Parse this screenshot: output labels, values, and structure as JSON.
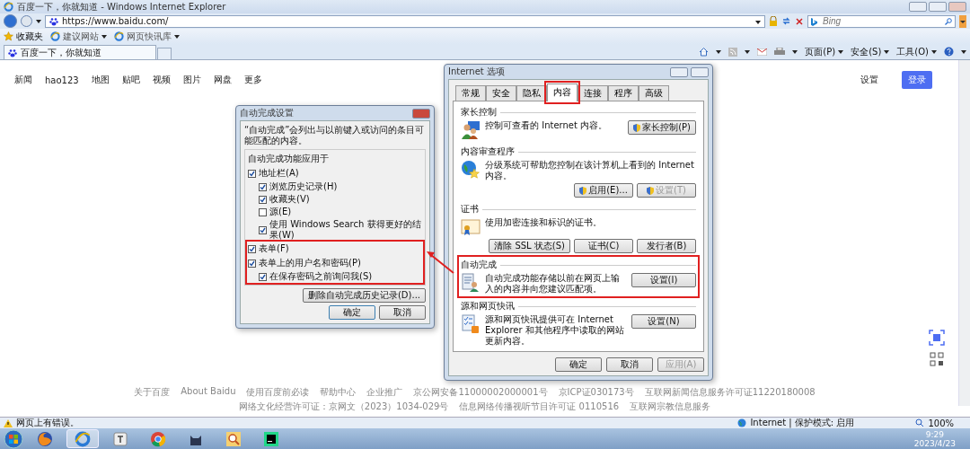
{
  "window": {
    "title": "百度一下，你就知道 - Windows Internet Explorer"
  },
  "address_bar": {
    "url": "https://www.baidu.com/"
  },
  "search": {
    "placeholder": "Bing"
  },
  "favorites_bar": {
    "items": [
      {
        "label": "收藏夹",
        "menu": false
      },
      {
        "label": "建议网站",
        "menu": true
      },
      {
        "label": "网页快讯库",
        "menu": true
      }
    ]
  },
  "tabs": [
    {
      "label": "百度一下，你就知道",
      "selected": true
    }
  ],
  "command_bar": {
    "menus": [
      "页面(P)",
      "安全(S)",
      "工具(O)"
    ]
  },
  "page": {
    "nav": [
      "新闻",
      "hao123",
      "地图",
      "贴吧",
      "视频",
      "图片",
      "网盘",
      "更多"
    ],
    "settings": "设置",
    "login": "登录",
    "footer": [
      "关于百度",
      "About Baidu",
      "使用百度前必读",
      "帮助中心",
      "企业推广",
      "京公网安备11000002000001号",
      "京ICP证030173号",
      "互联网新闻信息服务许可证11220180008",
      "网络文化经营许可证：京网文（2023）1034-029号",
      "信息网络传播视听节目许可证 0110516",
      "互联网宗教信息服务"
    ]
  },
  "internet_options": {
    "title": "Internet 选项",
    "tabs": [
      {
        "label": "常规",
        "selected": false,
        "highlighted": false
      },
      {
        "label": "安全",
        "selected": false,
        "highlighted": false
      },
      {
        "label": "隐私",
        "selected": false,
        "highlighted": false
      },
      {
        "label": "内容",
        "selected": true,
        "highlighted": true
      },
      {
        "label": "连接",
        "selected": false,
        "highlighted": false
      },
      {
        "label": "程序",
        "selected": false,
        "highlighted": false
      },
      {
        "label": "高级",
        "selected": false,
        "highlighted": false
      }
    ],
    "sections": [
      {
        "title": "家长控制",
        "text": "控制可查看的 Internet 内容。",
        "highlighted": false,
        "buttons": [
          {
            "label": "家长控制(P)",
            "disabled": false,
            "shield": true
          }
        ]
      },
      {
        "title": "内容审查程序",
        "text": "分级系统可帮助您控制在该计算机上看到的 Internet 内容。",
        "highlighted": false,
        "buttons": [
          {
            "label": "启用(E)...",
            "disabled": false,
            "shield": true
          },
          {
            "label": "设置(T)",
            "disabled": true,
            "shield": true
          }
        ]
      },
      {
        "title": "证书",
        "text": "使用加密连接和标识的证书。",
        "highlighted": false,
        "buttons": [
          {
            "label": "清除 SSL 状态(S)",
            "disabled": false,
            "shield": false
          },
          {
            "label": "证书(C)",
            "disabled": false,
            "shield": false
          },
          {
            "label": "发行者(B)",
            "disabled": false,
            "shield": false
          }
        ]
      },
      {
        "title": "自动完成",
        "text": "自动完成功能存储以前在网页上输入的内容并向您建议匹配项。",
        "highlighted": true,
        "buttons": [
          {
            "label": "设置(I)",
            "disabled": false,
            "shield": false
          }
        ]
      },
      {
        "title": "源和网页快讯",
        "text": "源和网页快讯提供可在 Internet Explorer 和其他程序中读取的网站更新内容。",
        "highlighted": false,
        "buttons": [
          {
            "label": "设置(N)",
            "disabled": false,
            "shield": false
          }
        ]
      }
    ],
    "buttons": [
      {
        "label": "确定",
        "disabled": false
      },
      {
        "label": "取消",
        "disabled": false
      },
      {
        "label": "应用(A)",
        "disabled": true
      }
    ]
  },
  "autocomplete_settings": {
    "title": "自动完成设置",
    "description": "“自动完成”会列出与以前键入或访问的条目可能匹配的内容。",
    "group": "自动完成功能应用于",
    "groups": [
      {
        "highlighted": false,
        "options": [
          {
            "label": "地址栏(A)",
            "checked": true,
            "children": [
              {
                "label": "浏览历史记录(H)",
                "checked": true
              },
              {
                "label": "收藏夹(V)",
                "checked": true
              },
              {
                "label": "源(E)",
                "checked": false
              },
              {
                "label": "使用 Windows Search 获得更好的结果(W)",
                "checked": true
              }
            ]
          }
        ]
      },
      {
        "highlighted": true,
        "options": [
          {
            "label": "表单(F)",
            "checked": true
          },
          {
            "label": "表单上的用户名和密码(P)",
            "checked": true,
            "children": [
              {
                "label": "在保存密码之前询问我(S)",
                "checked": true
              }
            ]
          }
        ]
      }
    ],
    "delete_button": "删除自动完成历史记录(D)...",
    "buttons": [
      {
        "label": "确定",
        "default": true
      },
      {
        "label": "取消",
        "default": false
      }
    ]
  },
  "status_bar": {
    "message": "网页上有错误。",
    "zone": "Internet | 保护模式: 启用",
    "zoom": "100%"
  },
  "taskbar": {
    "apps": [
      {
        "active": false
      },
      {
        "active": true
      },
      {
        "active": false
      },
      {
        "active": false
      },
      {
        "active": false
      },
      {
        "active": false
      },
      {
        "active": false
      }
    ],
    "time": "9:29",
    "date": "2023/4/23"
  }
}
